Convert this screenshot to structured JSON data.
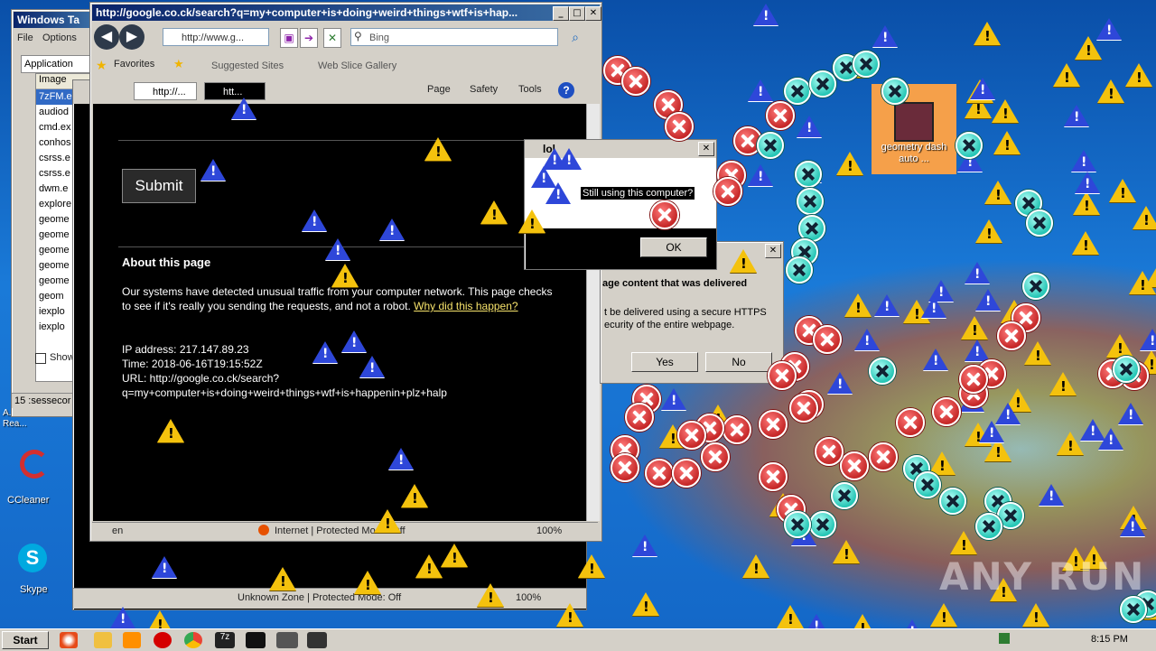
{
  "desktop": {
    "shortcuts": [
      {
        "label": "CCleaner"
      },
      {
        "label": "Skype"
      }
    ],
    "highlighted_icon_label": "geometry dash auto ...",
    "left_partial_labels": [
      "A...",
      "Rea..."
    ]
  },
  "task_manager": {
    "title": "Windows Ta",
    "menu": [
      "File",
      "Options"
    ],
    "tab": "Application",
    "column": "Image",
    "processes": [
      "7zFM.e",
      "audiod",
      "cmd.ex",
      "conhos",
      "csrss.e",
      "csrss.e",
      "dwm.e",
      "explore",
      "geome",
      "geome",
      "geome",
      "geome",
      "geome",
      "geom",
      "iexplo",
      "iexplo"
    ],
    "show_checkbox": "Show",
    "status": "15 :sessecor"
  },
  "ie_front": {
    "title": "http://google.co.ck/search?q=my+computer+is+doing+weird+things+wtf+is+hap...",
    "address": "http://www.g...",
    "search_placeholder": "Bing",
    "favorites": "Favorites",
    "suggested": "Suggested Sites",
    "webslice": "Web Slice Gallery",
    "tabs": [
      "http://...",
      "htt..."
    ],
    "toolbar": [
      "Page",
      "Safety",
      "Tools"
    ],
    "content": {
      "submit": "Submit",
      "about_heading": "About this page",
      "para": "Our systems have detected unusual traffic from your computer network. This page checks to see if it's really you sending the requests, and not a robot.",
      "link": "Why did this happen?",
      "ip": "IP address: 217.147.89.23",
      "time": "Time: 2018-06-16T19:15:52Z",
      "url1": "URL: http://google.co.ck/search?",
      "url2": "q=my+computer+is+doing+weird+things+wtf+is+happenin+plz+halp"
    },
    "status_lang": "en",
    "status_zone": "Internet | Protected Mode: Off",
    "zoom": "100%"
  },
  "ie_back": {
    "status_zone": "Unknown Zone | Protected Mode: Off",
    "zoom": "100%"
  },
  "dialog_lol": {
    "title": "lol",
    "message": "Still using this computer?",
    "ok": "OK"
  },
  "dialog_security": {
    "heading": "age content that was delivered",
    "line1": "t be delivered using a secure HTTPS",
    "line2": "ecurity of the entire webpage.",
    "yes": "Yes",
    "no": "No"
  },
  "taskbar": {
    "start": "Start",
    "clock": "8:15 PM"
  },
  "watermark": "ANY RUN",
  "colors": {
    "title_blue": "#0a246a",
    "desktop_blue": "#1565c0",
    "warning_yellow": "#f4c20d",
    "error_red": "#c62828"
  }
}
